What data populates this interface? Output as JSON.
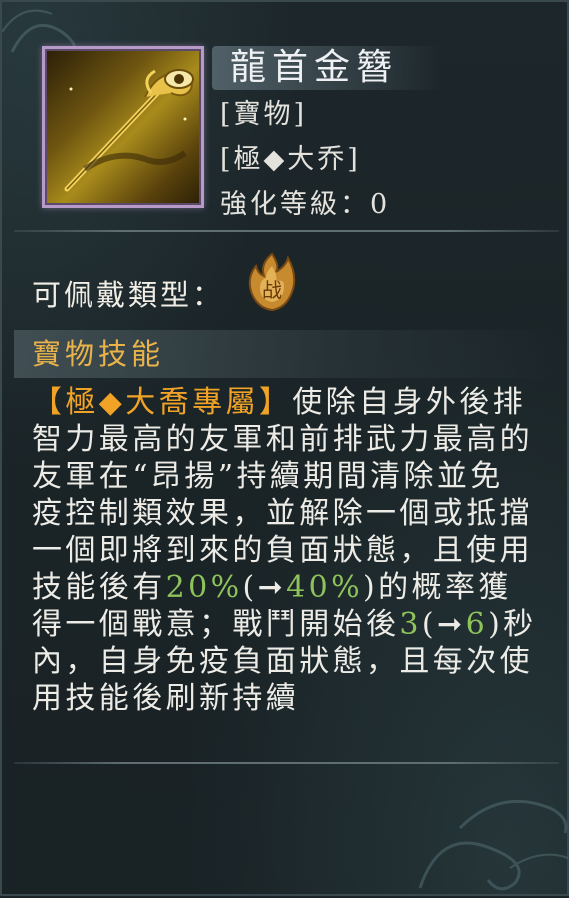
{
  "item": {
    "name": "龍首金簪",
    "category": "[寶物]",
    "exclusive_tag": "[極◆大乔]",
    "upgrade_label": "強化等級：",
    "upgrade_level": "0"
  },
  "wear": {
    "label": "可佩戴類型：",
    "icon": "war-flame-icon",
    "icon_text": "战"
  },
  "skill": {
    "section_title": "寶物技能",
    "segments": [
      {
        "text": "【極◆大喬專屬】",
        "style": "tag"
      },
      {
        "text": "使除自身外後排智力最高的友軍和前排武力最高的友軍在“昂揚”持續期間清除並免疫控制類效果，並解除一個或抵擋一個即將到來的負面狀態，且使用技能後有",
        "style": "normal"
      },
      {
        "text": "20%",
        "style": "num"
      },
      {
        "text": "(➞",
        "style": "normal"
      },
      {
        "text": "40%",
        "style": "num"
      },
      {
        "text": ")的概率獲得一個戰意；戰鬥開始後",
        "style": "normal"
      },
      {
        "text": "3",
        "style": "num"
      },
      {
        "text": "(➞",
        "style": "normal"
      },
      {
        "text": "6",
        "style": "num"
      },
      {
        "text": ")秒內，自身免疫負面狀態，且每次使用技能後刷新持續",
        "style": "normal"
      }
    ]
  },
  "colors": {
    "accent_orange": "#f0a326",
    "number_green": "#8ec25a",
    "frame_purple": "#b89ac9"
  }
}
